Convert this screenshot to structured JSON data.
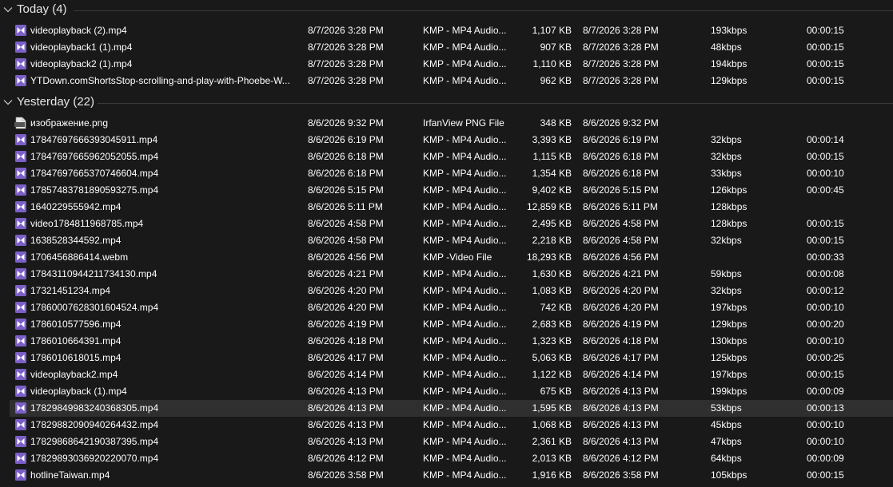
{
  "groups": [
    {
      "title": "Today (4)",
      "rows": [
        {
          "name": "videoplayback (2).mp4",
          "date": "8/7/2026 3:28 PM",
          "type": "KMP - MP4 Audio...",
          "size": "1,107 KB",
          "modified": "8/7/2026 3:28 PM",
          "bitrate": "193kbps",
          "length": "00:00:15",
          "icon": "video-file-icon"
        },
        {
          "name": "videoplayback1 (1).mp4",
          "date": "8/7/2026 3:28 PM",
          "type": "KMP - MP4 Audio...",
          "size": "907 KB",
          "modified": "8/7/2026 3:28 PM",
          "bitrate": "48kbps",
          "length": "00:00:15",
          "icon": "video-file-icon"
        },
        {
          "name": "videoplayback2 (1).mp4",
          "date": "8/7/2026 3:28 PM",
          "type": "KMP - MP4 Audio...",
          "size": "1,110 KB",
          "modified": "8/7/2026 3:28 PM",
          "bitrate": "194kbps",
          "length": "00:00:15",
          "icon": "video-file-icon"
        },
        {
          "name": "YTDown.comShortsStop-scrolling-and-play-with-Phoebe-W...",
          "date": "8/7/2026 3:28 PM",
          "type": "KMP - MP4 Audio...",
          "size": "962 KB",
          "modified": "8/7/2026 3:28 PM",
          "bitrate": "129kbps",
          "length": "00:00:15",
          "icon": "video-file-icon"
        }
      ]
    },
    {
      "title": "Yesterday (22)",
      "rows": [
        {
          "name": "изображение.png",
          "date": "8/6/2026 9:32 PM",
          "type": "IrfanView PNG File",
          "size": "348 KB",
          "modified": "8/6/2026 9:32 PM",
          "bitrate": "",
          "length": "",
          "icon": "png-file-icon"
        },
        {
          "name": "17847697666393045911.mp4",
          "date": "8/6/2026 6:19 PM",
          "type": "KMP - MP4 Audio...",
          "size": "3,393 KB",
          "modified": "8/6/2026 6:19 PM",
          "bitrate": "32kbps",
          "length": "00:00:14",
          "icon": "video-file-icon"
        },
        {
          "name": "17847697665962052055.mp4",
          "date": "8/6/2026 6:18 PM",
          "type": "KMP - MP4 Audio...",
          "size": "1,115 KB",
          "modified": "8/6/2026 6:18 PM",
          "bitrate": "32kbps",
          "length": "00:00:15",
          "icon": "video-file-icon"
        },
        {
          "name": "17847697665370746604.mp4",
          "date": "8/6/2026 6:18 PM",
          "type": "KMP - MP4 Audio...",
          "size": "1,354 KB",
          "modified": "8/6/2026 6:18 PM",
          "bitrate": "33kbps",
          "length": "00:00:10",
          "icon": "video-file-icon"
        },
        {
          "name": "17857483781890593275.mp4",
          "date": "8/6/2026 5:15 PM",
          "type": "KMP - MP4 Audio...",
          "size": "9,402 KB",
          "modified": "8/6/2026 5:15 PM",
          "bitrate": "126kbps",
          "length": "00:00:45",
          "icon": "video-file-icon"
        },
        {
          "name": "1640229555942.mp4",
          "date": "8/6/2026 5:11 PM",
          "type": "KMP - MP4 Audio...",
          "size": "12,859 KB",
          "modified": "8/6/2026 5:11 PM",
          "bitrate": "128kbps",
          "length": "",
          "icon": "video-file-icon"
        },
        {
          "name": "video1784811968785.mp4",
          "date": "8/6/2026 4:58 PM",
          "type": "KMP - MP4 Audio...",
          "size": "2,495 KB",
          "modified": "8/6/2026 4:58 PM",
          "bitrate": "128kbps",
          "length": "00:00:15",
          "icon": "video-file-icon"
        },
        {
          "name": "1638528344592.mp4",
          "date": "8/6/2026 4:58 PM",
          "type": "KMP - MP4 Audio...",
          "size": "2,218 KB",
          "modified": "8/6/2026 4:58 PM",
          "bitrate": "32kbps",
          "length": "00:00:15",
          "icon": "video-file-icon"
        },
        {
          "name": "1706456886414.webm",
          "date": "8/6/2026 4:56 PM",
          "type": "KMP -Video File",
          "size": "18,293 KB",
          "modified": "8/6/2026 4:56 PM",
          "bitrate": "",
          "length": "00:00:33",
          "icon": "video-file-icon"
        },
        {
          "name": "17843110944211734130.mp4",
          "date": "8/6/2026 4:21 PM",
          "type": "KMP - MP4 Audio...",
          "size": "1,630 KB",
          "modified": "8/6/2026 4:21 PM",
          "bitrate": "59kbps",
          "length": "00:00:08",
          "icon": "video-file-icon"
        },
        {
          "name": "17321451234.mp4",
          "date": "8/6/2026 4:20 PM",
          "type": "KMP - MP4 Audio...",
          "size": "1,083 KB",
          "modified": "8/6/2026 4:20 PM",
          "bitrate": "32kbps",
          "length": "00:00:12",
          "icon": "video-file-icon"
        },
        {
          "name": "17860007628301604524.mp4",
          "date": "8/6/2026 4:20 PM",
          "type": "KMP - MP4 Audio...",
          "size": "742 KB",
          "modified": "8/6/2026 4:20 PM",
          "bitrate": "197kbps",
          "length": "00:00:10",
          "icon": "video-file-icon"
        },
        {
          "name": "1786010577596.mp4",
          "date": "8/6/2026 4:19 PM",
          "type": "KMP - MP4 Audio...",
          "size": "2,683 KB",
          "modified": "8/6/2026 4:19 PM",
          "bitrate": "129kbps",
          "length": "00:00:20",
          "icon": "video-file-icon"
        },
        {
          "name": "1786010664391.mp4",
          "date": "8/6/2026 4:18 PM",
          "type": "KMP - MP4 Audio...",
          "size": "1,323 KB",
          "modified": "8/6/2026 4:18 PM",
          "bitrate": "130kbps",
          "length": "00:00:10",
          "icon": "video-file-icon"
        },
        {
          "name": "1786010618015.mp4",
          "date": "8/6/2026 4:17 PM",
          "type": "KMP - MP4 Audio...",
          "size": "5,063 KB",
          "modified": "8/6/2026 4:17 PM",
          "bitrate": "125kbps",
          "length": "00:00:25",
          "icon": "video-file-icon"
        },
        {
          "name": "videoplayback2.mp4",
          "date": "8/6/2026 4:14 PM",
          "type": "KMP - MP4 Audio...",
          "size": "1,122 KB",
          "modified": "8/6/2026 4:14 PM",
          "bitrate": "197kbps",
          "length": "00:00:15",
          "icon": "video-file-icon"
        },
        {
          "name": "videoplayback (1).mp4",
          "date": "8/6/2026 4:13 PM",
          "type": "KMP - MP4 Audio...",
          "size": "675 KB",
          "modified": "8/6/2026 4:13 PM",
          "bitrate": "199kbps",
          "length": "00:00:09",
          "icon": "video-file-icon"
        },
        {
          "name": "17829849983240368305.mp4",
          "date": "8/6/2026 4:13 PM",
          "type": "KMP - MP4 Audio...",
          "size": "1,595 KB",
          "modified": "8/6/2026 4:13 PM",
          "bitrate": "53kbps",
          "length": "00:00:13",
          "icon": "video-file-icon",
          "selected": true
        },
        {
          "name": "17829882090940264432.mp4",
          "date": "8/6/2026 4:13 PM",
          "type": "KMP - MP4 Audio...",
          "size": "1,068 KB",
          "modified": "8/6/2026 4:13 PM",
          "bitrate": "45kbps",
          "length": "00:00:10",
          "icon": "video-file-icon"
        },
        {
          "name": "17829868642190387395.mp4",
          "date": "8/6/2026 4:13 PM",
          "type": "KMP - MP4 Audio...",
          "size": "2,361 KB",
          "modified": "8/6/2026 4:13 PM",
          "bitrate": "47kbps",
          "length": "00:00:10",
          "icon": "video-file-icon"
        },
        {
          "name": "17829893036920220070.mp4",
          "date": "8/6/2026 4:12 PM",
          "type": "KMP - MP4 Audio...",
          "size": "2,013 KB",
          "modified": "8/6/2026 4:12 PM",
          "bitrate": "64kbps",
          "length": "00:00:09",
          "icon": "video-file-icon"
        },
        {
          "name": "hotlineTaiwan.mp4",
          "date": "8/6/2026 3:58 PM",
          "type": "KMP - MP4 Audio...",
          "size": "1,916 KB",
          "modified": "8/6/2026 3:58 PM",
          "bitrate": "105kbps",
          "length": "00:00:15",
          "icon": "video-file-icon"
        }
      ]
    }
  ],
  "colors": {
    "background": "#191919",
    "text": "#ffffff",
    "header_text": "#e6e6e6",
    "separator": "#3a3a3a",
    "selected_row": "#2f2f2f",
    "video_icon": "#7b5fc7",
    "png_icon": "#e8e8e8"
  }
}
